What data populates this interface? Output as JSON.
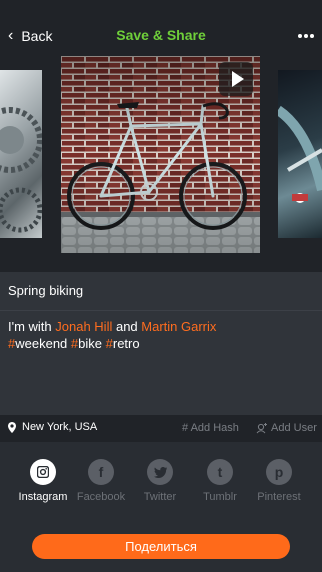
{
  "header": {
    "back_label": "Back",
    "title": "Save & Share",
    "title_color": "#6fcf3a"
  },
  "photo": {
    "subject": "bicycle-photo",
    "has_video": true
  },
  "caption": {
    "title": "Spring biking",
    "line1_prefix": "I'm with ",
    "person1": "Jonah Hill",
    "line1_mid": " and ",
    "person2": "Martin Garrix",
    "tags": [
      "#weekend",
      "#bike",
      "#retro"
    ],
    "highlight_color": "#ff6d1f"
  },
  "meta": {
    "location": "New York, USA",
    "add_hash": "# Add Hash",
    "add_user": "Add User"
  },
  "share": {
    "items": [
      {
        "label": "Instagram",
        "icon": "instagram-icon",
        "glyph": "",
        "active": true
      },
      {
        "label": "Facebook",
        "icon": "facebook-icon",
        "glyph": "f",
        "active": false
      },
      {
        "label": "Twitter",
        "icon": "twitter-icon",
        "glyph": "",
        "active": false
      },
      {
        "label": "Tumblr",
        "icon": "tumblr-icon",
        "glyph": "t",
        "active": false
      },
      {
        "label": "Pinterest",
        "icon": "pinterest-icon",
        "glyph": "p",
        "active": false
      }
    ]
  },
  "cta": {
    "label": "Поделиться",
    "color": "#ff6a1a"
  }
}
